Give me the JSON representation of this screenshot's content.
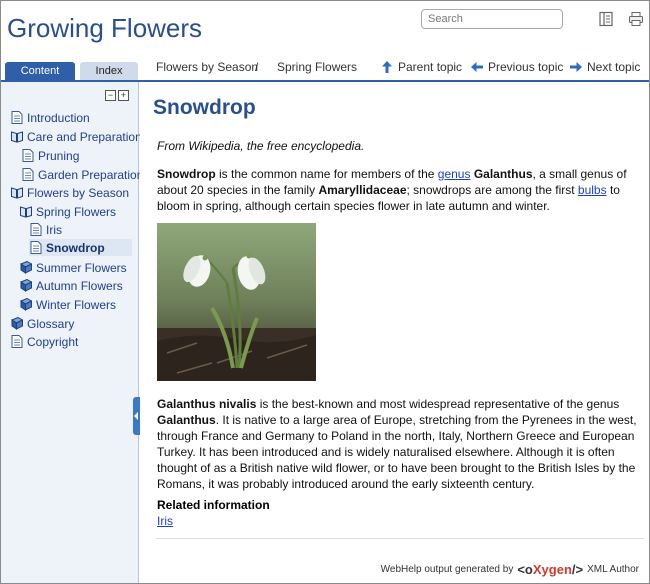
{
  "header": {
    "title": "Growing Flowers",
    "search_placeholder": "Search",
    "toc_icon": "toc-icon",
    "print_icon": "print-icon"
  },
  "tabs": [
    {
      "label": "Content",
      "active": true
    },
    {
      "label": "Index",
      "active": false
    }
  ],
  "breadcrumb": {
    "items": [
      "Flowers by Season",
      "Spring Flowers"
    ],
    "separator": "/"
  },
  "nav": {
    "parent": "Parent topic",
    "previous": "Previous topic",
    "next": "Next topic"
  },
  "toc": [
    {
      "label": "Introduction",
      "icon": "page-icon"
    },
    {
      "label": "Care and Preparation",
      "icon": "book-open-icon"
    },
    {
      "label": "Pruning",
      "icon": "page-icon"
    },
    {
      "label": "Garden Preparation",
      "icon": "page-icon"
    },
    {
      "label": "Flowers by Season",
      "icon": "book-open-icon"
    },
    {
      "label": "Spring Flowers",
      "icon": "book-open-icon"
    },
    {
      "label": "Iris",
      "icon": "page-icon"
    },
    {
      "label": "Snowdrop",
      "icon": "page-icon",
      "selected": true
    },
    {
      "label": "Summer Flowers",
      "icon": "book-closed-icon"
    },
    {
      "label": "Autumn Flowers",
      "icon": "book-closed-icon"
    },
    {
      "label": "Winter Flowers",
      "icon": "book-closed-icon"
    },
    {
      "label": "Glossary",
      "icon": "book-closed-icon"
    },
    {
      "label": "Copyright",
      "icon": "page-icon"
    }
  ],
  "topic": {
    "title": "Snowdrop",
    "source": "From Wikipedia, the free encyclopedia.",
    "p1": {
      "t1": "Snowdrop",
      "t2": " is the common name for members of the ",
      "l1": "genus",
      "t3": " ",
      "t4": "Galanthus",
      "t5": ", a small genus of about 20 species in the family ",
      "t6": "Amaryllidaceae",
      "t7": "; snowdrops are among the first ",
      "l2": "bulbs",
      "t8": " to bloom in spring, although certain species flower in late autumn and winter."
    },
    "p2": {
      "t1": "Galanthus nivalis",
      "t2": " is the best-known and most widespread representative of the genus ",
      "t3": "Galanthus",
      "t4": ". It is native to a large area of Europe, stretching from the Pyrenees in the west, through France and Germany to Poland in the north, Italy, Northern Greece and European Turkey. It has been introduced and is widely naturalised elsewhere. Although it is often thought of as a British native wild flower, or to have been brought to the British Isles by the Romans, it was probably introduced around the early sixteenth century."
    },
    "related_heading": "Related information",
    "related_link": "Iris"
  },
  "footer": {
    "prefix": "WebHelp output generated by",
    "brand_left": "<o",
    "brand_mid": "Xygen",
    "brand_right": "/>",
    "suffix": "XML Author"
  },
  "colors": {
    "title": "#2a4f8f",
    "accent": "#2e5fa8",
    "sidebar_bg": "#eef3fa",
    "link": "#1a3fc7"
  }
}
